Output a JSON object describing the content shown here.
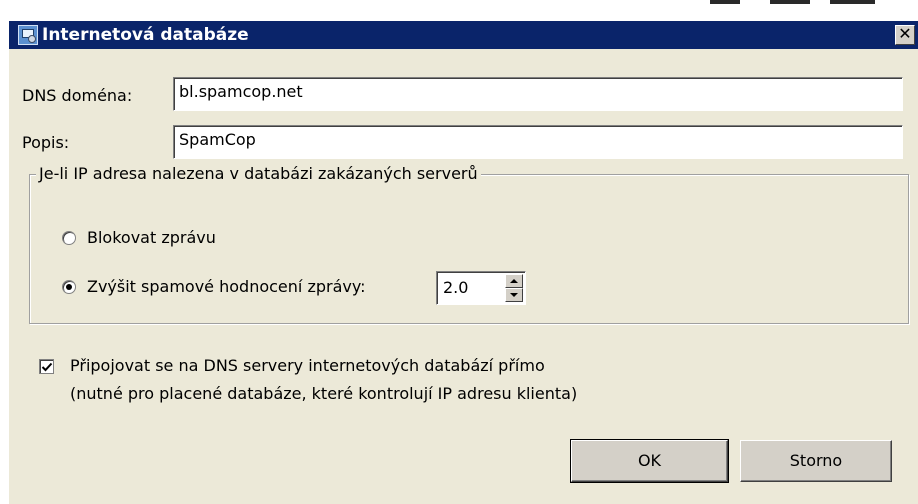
{
  "window": {
    "title": "Internetová databáze",
    "close_glyph": "✕",
    "title_color": "#0a246a",
    "face_color": "#ece9d8"
  },
  "form": {
    "dns_label": "DNS doména:",
    "dns_value": "bl.spamcop.net",
    "desc_label": "Popis:",
    "desc_value": "SpamCop"
  },
  "group": {
    "legend": "Je-li IP adresa nalezena v databázi zakázaných serverů",
    "option_block": {
      "label": "Blokovat zprávu",
      "selected": false
    },
    "option_raise": {
      "label": "Zvýšit spamové hodnocení zprávy:",
      "selected": true
    },
    "score_value": "2.0"
  },
  "direct": {
    "checked": true,
    "line1": "Připojovat se na DNS servery internetových databází přímo",
    "line2": "(nutné pro placené databáze, které kontrolují IP adresu klienta)"
  },
  "buttons": {
    "ok": "OK",
    "cancel": "Storno"
  },
  "icons": {
    "title": "database-window-icon",
    "close": "close-icon",
    "spin_up": "arrow-up-icon",
    "spin_down": "arrow-down-icon",
    "check": "checkmark-icon"
  }
}
